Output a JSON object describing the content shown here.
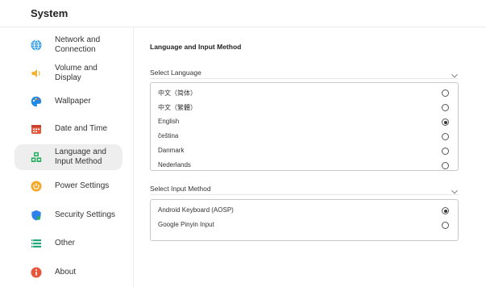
{
  "header": {
    "title": "System"
  },
  "sidebar": {
    "items": [
      {
        "label": "Network and Connection",
        "icon": "globe-icon",
        "color": "#2f9be8",
        "active": false
      },
      {
        "label": "Volume and Display",
        "icon": "speaker-icon",
        "color": "#f2b233",
        "active": false
      },
      {
        "label": "Wallpaper",
        "icon": "palette-icon",
        "color": "#1e88e5",
        "active": false
      },
      {
        "label": "Date and Time",
        "icon": "calendar-icon",
        "color": "#e8573b",
        "active": false
      },
      {
        "label": "Language and Input Method",
        "icon": "language-blocks-icon",
        "color": "#27ae60",
        "active": true
      },
      {
        "label": "Power Settings",
        "icon": "power-icon",
        "color": "#f5a623",
        "active": false
      },
      {
        "label": "Security Settings",
        "icon": "shield-icon",
        "color": "#2f80ed",
        "active": false
      },
      {
        "label": "Other",
        "icon": "list-icon",
        "color": "#1fa67a",
        "active": false
      },
      {
        "label": "About",
        "icon": "info-icon",
        "color": "#e8573b",
        "active": false
      }
    ]
  },
  "main": {
    "title": "Language and Input Method",
    "language": {
      "label": "Select Language",
      "options": [
        {
          "label": "中文（简体）",
          "selected": false
        },
        {
          "label": "中文（繁體）",
          "selected": false
        },
        {
          "label": "English",
          "selected": true
        },
        {
          "label": "čeština",
          "selected": false
        },
        {
          "label": "Danmark",
          "selected": false
        },
        {
          "label": "Nederlands",
          "selected": false
        }
      ]
    },
    "input_method": {
      "label": "Select Input Method",
      "options": [
        {
          "label": "Android Keyboard (AOSP)",
          "selected": true
        },
        {
          "label": "Google Pinyin Input",
          "selected": false
        }
      ]
    }
  }
}
